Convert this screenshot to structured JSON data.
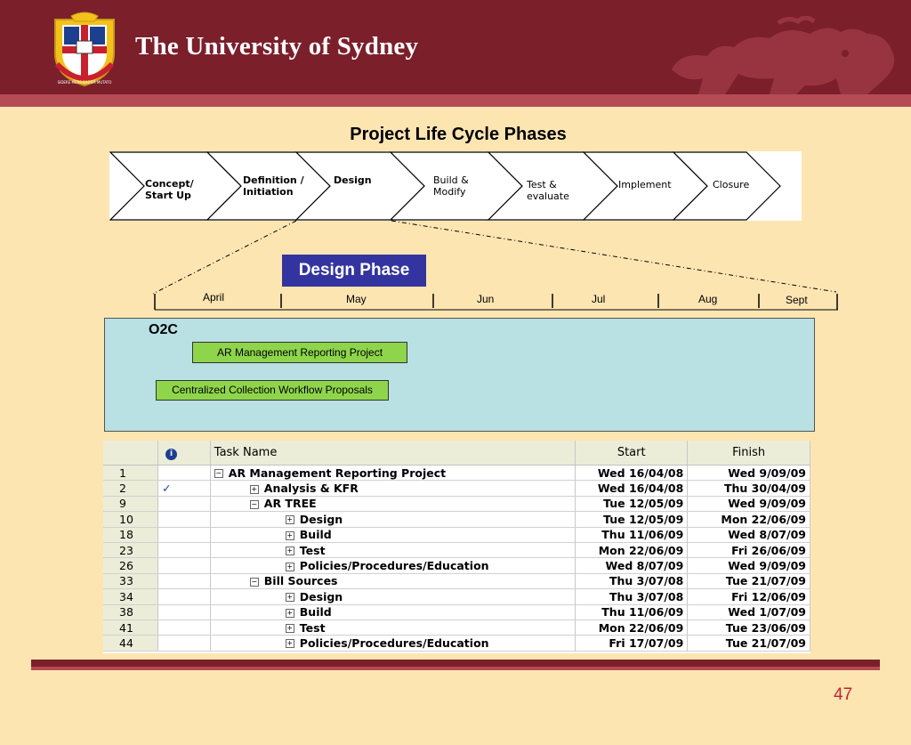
{
  "header": {
    "title": "The University of Sydney",
    "crest_motto": "SIDERE MENS EADEM MUTATO",
    "crest_book_text": "SCI\nENT"
  },
  "slide": {
    "title": "Project Life Cycle Phases"
  },
  "phases": [
    {
      "label_line1": "Concept/",
      "label_line2": "Start Up"
    },
    {
      "label_line1": "Definition /",
      "label_line2": "Initiation"
    },
    {
      "label_line1": "Design",
      "label_line2": ""
    },
    {
      "label_line1": "Build &",
      "label_line2": "Modify"
    },
    {
      "label_line1": "Test &",
      "label_line2": "evaluate"
    },
    {
      "label_line1": "Implement",
      "label_line2": ""
    },
    {
      "label_line1": "Closure",
      "label_line2": ""
    }
  ],
  "design_phase_label": "Design Phase",
  "months": [
    "April",
    "May",
    "Jun",
    "Jul",
    "Aug",
    "Sept"
  ],
  "o2c": {
    "label": "O2C",
    "projects": [
      "AR Management Reporting Project",
      "Centralized Collection Workflow Proposals"
    ]
  },
  "table": {
    "headers": {
      "info": "i",
      "task": "Task Name",
      "start": "Start",
      "finish": "Finish"
    },
    "rows": [
      {
        "id": "1",
        "check": "",
        "toggle": "−",
        "indent": 0,
        "name": "AR Management Reporting Project",
        "start": "Wed 16/04/08",
        "finish": "Wed 9/09/09"
      },
      {
        "id": "2",
        "check": "✓",
        "toggle": "+",
        "indent": 1,
        "name": "Analysis & KFR",
        "start": "Wed 16/04/08",
        "finish": "Thu 30/04/09"
      },
      {
        "id": "9",
        "check": "",
        "toggle": "−",
        "indent": 1,
        "name": "AR TREE",
        "start": "Tue 12/05/09",
        "finish": "Wed 9/09/09"
      },
      {
        "id": "10",
        "check": "",
        "toggle": "+",
        "indent": 2,
        "name": "Design",
        "start": "Tue 12/05/09",
        "finish": "Mon 22/06/09"
      },
      {
        "id": "18",
        "check": "",
        "toggle": "+",
        "indent": 2,
        "name": "Build",
        "start": "Thu 11/06/09",
        "finish": "Wed 8/07/09"
      },
      {
        "id": "23",
        "check": "",
        "toggle": "+",
        "indent": 2,
        "name": "Test",
        "start": "Mon 22/06/09",
        "finish": "Fri 26/06/09"
      },
      {
        "id": "26",
        "check": "",
        "toggle": "+",
        "indent": 2,
        "name": "Policies/Procedures/Education",
        "start": "Wed 8/07/09",
        "finish": "Wed 9/09/09"
      },
      {
        "id": "33",
        "check": "",
        "toggle": "−",
        "indent": 1,
        "name": "Bill Sources",
        "start": "Thu 3/07/08",
        "finish": "Tue 21/07/09"
      },
      {
        "id": "34",
        "check": "",
        "toggle": "+",
        "indent": 2,
        "name": "Design",
        "start": "Thu 3/07/08",
        "finish": "Fri 12/06/09"
      },
      {
        "id": "38",
        "check": "",
        "toggle": "+",
        "indent": 2,
        "name": "Build",
        "start": "Thu 11/06/09",
        "finish": "Wed 1/07/09"
      },
      {
        "id": "41",
        "check": "",
        "toggle": "+",
        "indent": 2,
        "name": "Test",
        "start": "Mon 22/06/09",
        "finish": "Tue 23/06/09"
      },
      {
        "id": "44",
        "check": "",
        "toggle": "+",
        "indent": 2,
        "name": "Policies/Procedures/Education",
        "start": "Fri 17/07/09",
        "finish": "Tue 21/07/09"
      }
    ]
  },
  "page_number": "47",
  "colors": {
    "header": "#7b1f2b",
    "background": "#fde5b2",
    "design_phase": "#3334a0",
    "o2c_box": "#b9e0e3",
    "project_box": "#8fd54b",
    "page_number": "#c0242f"
  }
}
